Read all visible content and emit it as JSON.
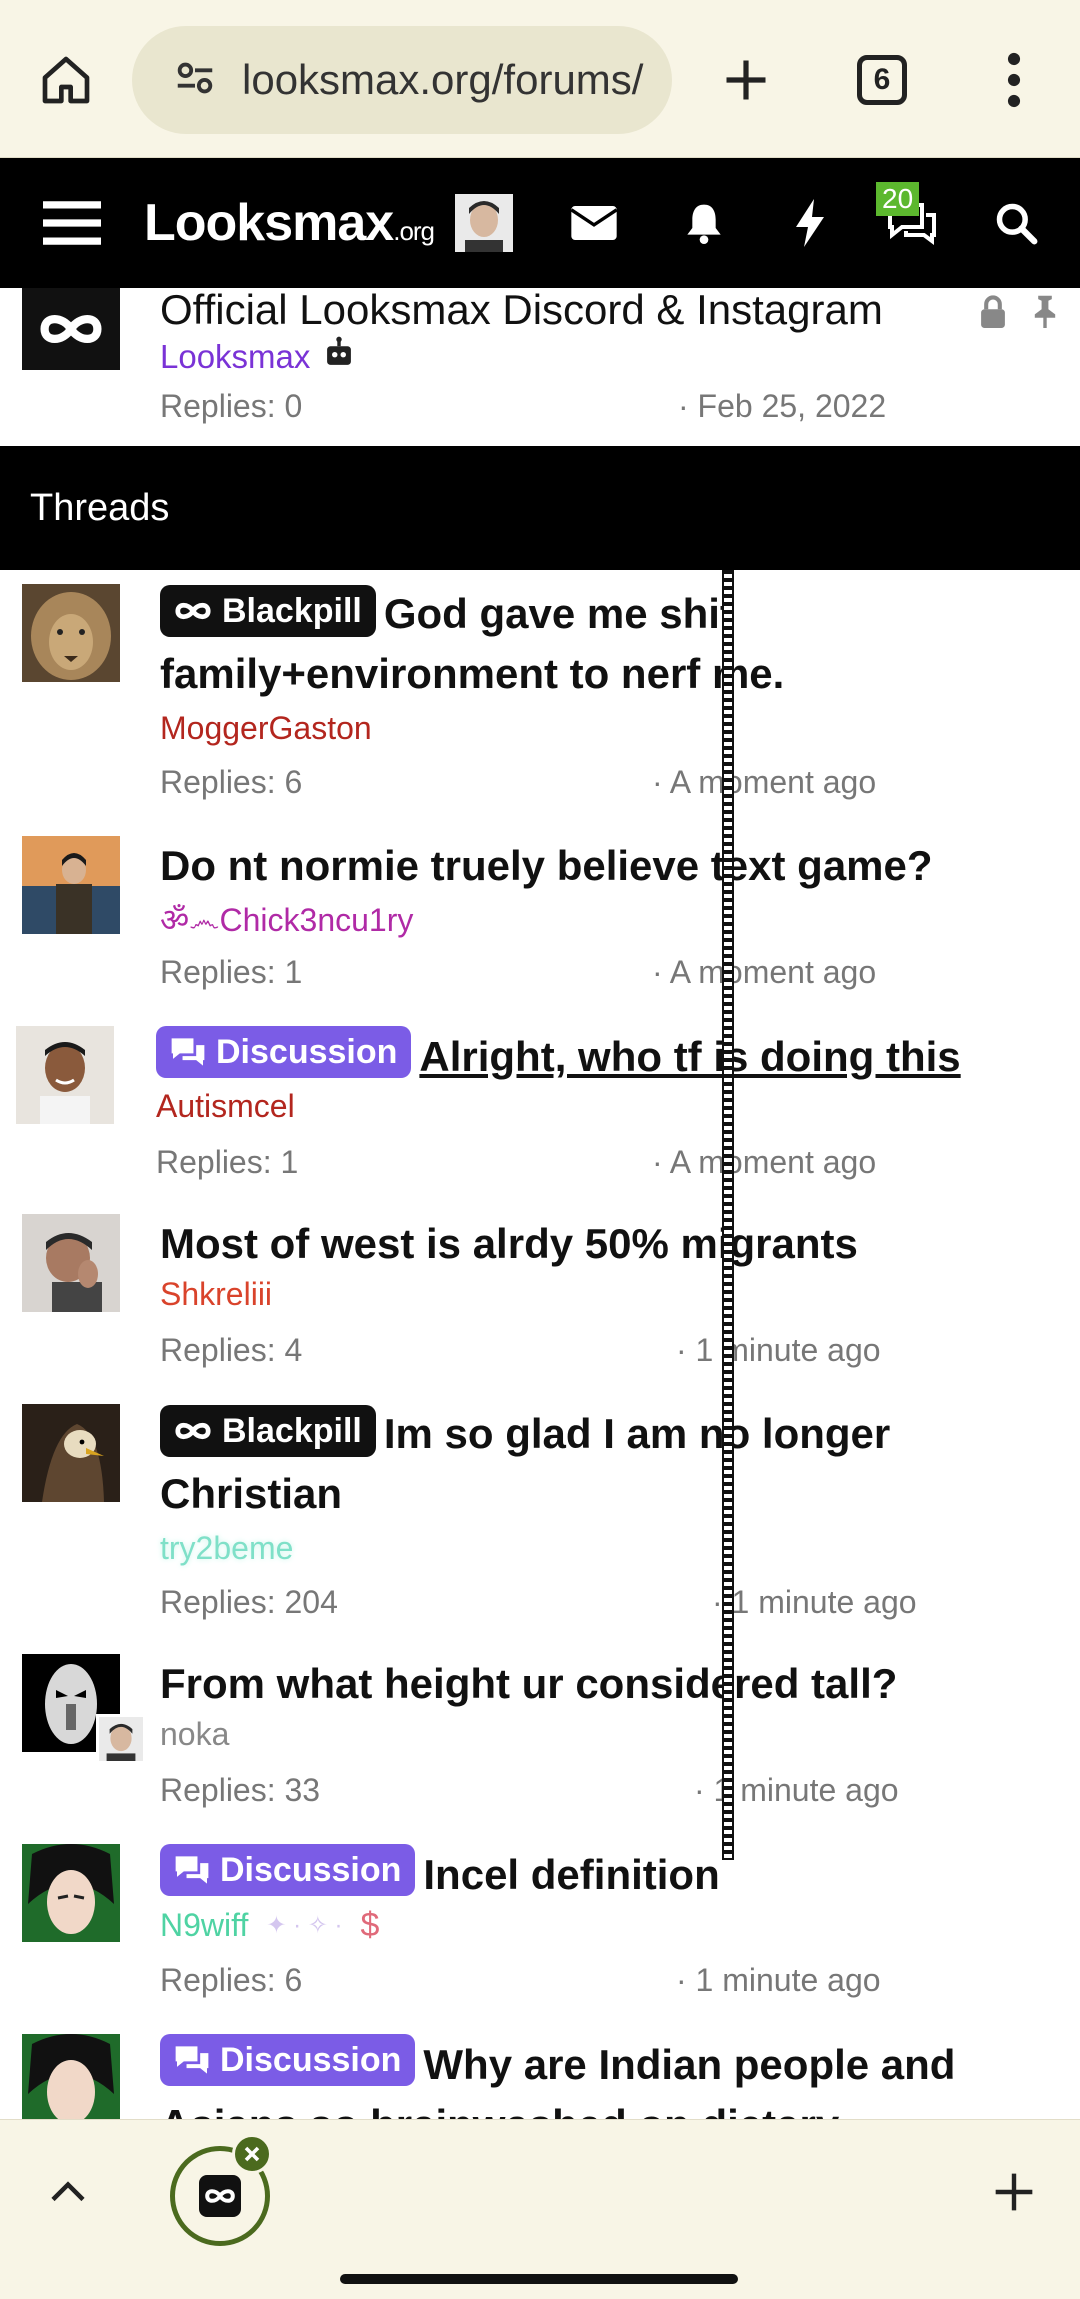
{
  "browser": {
    "url": "looksmax.org/forums/",
    "tab_count": "6"
  },
  "site": {
    "logo_main": "Looksmax",
    "logo_suffix": ".org",
    "messages_badge": "20"
  },
  "sticky": {
    "title": "Official Looksmax Discord & Instagram",
    "user": "Looksmax",
    "replies": "Replies: 0",
    "time": "· Feb 25, 2022"
  },
  "section": {
    "title": "Threads"
  },
  "threads": [
    {
      "prefix": "Blackpill",
      "title": "God gave me shit family+environment to nerf me.",
      "user": "MoggerGaston",
      "user_color": "#b3261e",
      "replies": "Replies: 6",
      "time": "· A moment ago"
    },
    {
      "prefix": "",
      "title": "Do nt normie truely believe text game?",
      "user": "ॐ෴Chick3ncu1ry",
      "user_color": "#b02aa6",
      "replies": "Replies: 1",
      "time": "· A moment ago"
    },
    {
      "prefix": "Discussion",
      "title": "Alright, who tf is doing this",
      "user": "Autismcel",
      "user_color": "#b3261e",
      "replies": "Replies: 1",
      "time": "· A moment ago"
    },
    {
      "prefix": "",
      "title": "Most of west is alrdy 50% migrants",
      "user": "Shkreliii",
      "user_color": "#d9432b",
      "replies": "Replies: 4",
      "time": "· 1 minute ago"
    },
    {
      "prefix": "Blackpill",
      "title": "Im so glad I am no longer Christian",
      "user": "try2beme",
      "user_color": "#7fe0c8",
      "replies": "Replies: 204",
      "time": "· 1 minute ago"
    },
    {
      "prefix": "",
      "title": "From what height ur considered tall?",
      "user": "noka",
      "user_color": "#888888",
      "replies": "Replies: 33",
      "time": "· 1 minute ago"
    },
    {
      "prefix": "Discussion",
      "title": "Incel definition",
      "user": "N9wiff",
      "user_color": "#4fd3a3",
      "replies": "Replies: 6",
      "time": "· 1 minute ago"
    },
    {
      "prefix": "Discussion",
      "title": "Why are Indian people and Asians so brainwashed on dietary practices?",
      "user": "",
      "user_color": "#888888",
      "replies": "",
      "time": ""
    }
  ]
}
